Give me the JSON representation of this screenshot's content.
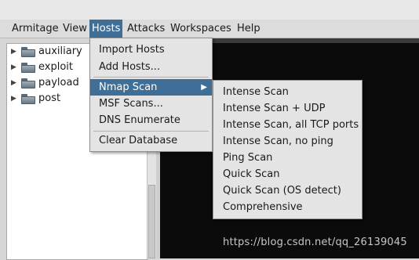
{
  "menubar": {
    "items": [
      {
        "label": "Armitage"
      },
      {
        "label": "View"
      },
      {
        "label": "Hosts"
      },
      {
        "label": "Attacks"
      },
      {
        "label": "Workspaces"
      },
      {
        "label": "Help"
      }
    ],
    "active": "Hosts"
  },
  "tree": {
    "items": [
      {
        "label": "auxiliary"
      },
      {
        "label": "exploit"
      },
      {
        "label": "payload"
      },
      {
        "label": "post"
      }
    ]
  },
  "hosts_menu": {
    "items": [
      {
        "label": "Import Hosts"
      },
      {
        "label": "Add Hosts..."
      },
      {
        "label": "Nmap Scan"
      },
      {
        "label": "MSF Scans..."
      },
      {
        "label": "DNS Enumerate"
      },
      {
        "label": "Clear Database"
      }
    ],
    "selected": "Nmap Scan"
  },
  "nmap_submenu": {
    "items": [
      {
        "label": "Intense Scan"
      },
      {
        "label": "Intense Scan + UDP"
      },
      {
        "label": "Intense Scan, all TCP ports"
      },
      {
        "label": "Intense Scan, no ping"
      },
      {
        "label": "Ping Scan"
      },
      {
        "label": "Quick Scan"
      },
      {
        "label": "Quick Scan (OS detect)"
      },
      {
        "label": "Comprehensive"
      }
    ]
  },
  "watermark": "https://blog.csdn.net/qq_26139045",
  "colors": {
    "selection": "#3f6f96",
    "console_bg": "#0b0b0b"
  }
}
